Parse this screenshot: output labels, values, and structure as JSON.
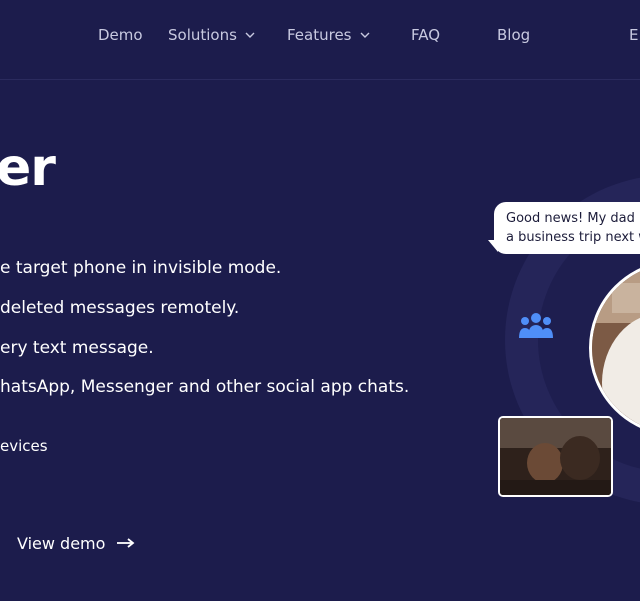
{
  "nav": {
    "items": [
      {
        "label": "Demo",
        "dropdown": false
      },
      {
        "label": "Solutions",
        "dropdown": true
      },
      {
        "label": "Features",
        "dropdown": true
      },
      {
        "label": "FAQ",
        "dropdown": false
      },
      {
        "label": "Blog",
        "dropdown": false
      }
    ],
    "language_label": "E"
  },
  "hero": {
    "headline": "er",
    "features": [
      "e target phone in invisible mode.",
      "deleted messages remotely.",
      "ery text message.",
      "hatsApp, Messenger and other social app chats."
    ],
    "devices_text": "evices",
    "demo_link_label": "View demo"
  },
  "chat_bubble": {
    "line1": "Good news! My dad",
    "line2": "a business trip next w"
  },
  "colors": {
    "background": "#1c1c4c",
    "nav_text": "#c8c9e0",
    "icon_blue": "#4f8ef7"
  },
  "icons": [
    "chevron-down-icon",
    "arrow-right-icon",
    "people-icon"
  ]
}
